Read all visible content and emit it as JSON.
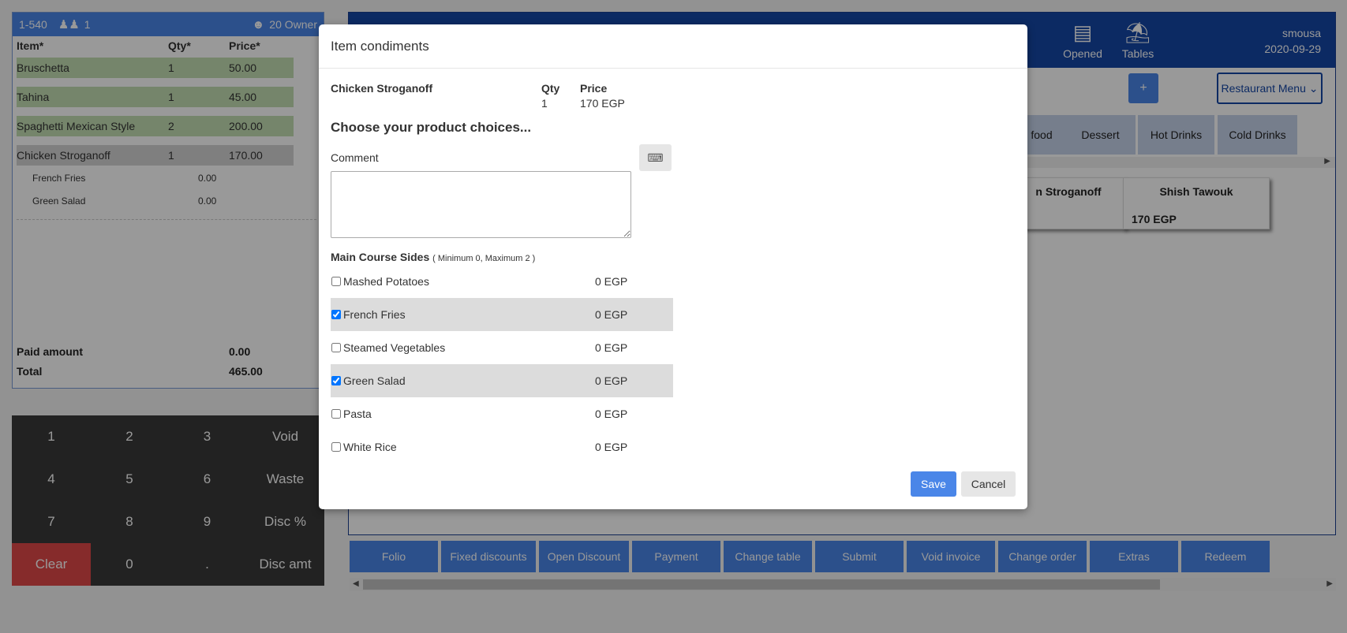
{
  "order": {
    "header": {
      "ref": "1-540",
      "guests_icon": "people-icon",
      "guests": "1",
      "owner_icon": "waiter-icon",
      "owner": "20 Owner"
    },
    "columns": {
      "item": "Item*",
      "qty": "Qty*",
      "price": "Price*"
    },
    "rows": [
      {
        "name": "Bruschetta",
        "qty": "1",
        "price": "50.00"
      },
      {
        "name": "Tahina",
        "qty": "1",
        "price": "45.00"
      },
      {
        "name": "Spaghetti Mexican Style",
        "qty": "2",
        "price": "200.00"
      },
      {
        "name": "Chicken Stroganoff",
        "qty": "1",
        "price": "170.00"
      }
    ],
    "subitems": [
      {
        "name": "French Fries",
        "price": "0.00"
      },
      {
        "name": "Green Salad",
        "price": "0.00"
      }
    ],
    "paid_label": "Paid amount",
    "paid_value": "0.00",
    "total_label": "Total",
    "total_value": "465.00"
  },
  "keypad": [
    "1",
    "2",
    "3",
    "Void",
    "4",
    "5",
    "6",
    "Waste",
    "7",
    "8",
    "9",
    "Disc %",
    "Clear",
    "0",
    ".",
    "Disc amt"
  ],
  "topbar": {
    "opened_label": "Opened",
    "tables_label": "Tables",
    "user": "smousa",
    "date": "2020-09-29"
  },
  "menu": {
    "plus": "+",
    "select": "Restaurant Menu"
  },
  "categories": [
    "food",
    "Dessert",
    "Hot Drinks",
    "Cold Drinks"
  ],
  "products": [
    {
      "name": "n Stroganoff",
      "price": ""
    },
    {
      "name": "Shish Tawouk",
      "price": "170 EGP"
    }
  ],
  "actions": [
    "Folio",
    "Fixed discounts",
    "Open Discount",
    "Payment",
    "Change table",
    "Submit",
    "Void invoice",
    "Change order",
    "Extras",
    "Redeem"
  ],
  "modal": {
    "title": "Item condiments",
    "item_name": "Chicken Stroganoff",
    "qty_label": "Qty",
    "qty_value": "1",
    "price_label": "Price",
    "price_value": "170 EGP",
    "choose": "Choose your product choices...",
    "comment_label": "Comment",
    "keyboard_icon": "keyboard-icon",
    "sides_title": "Main Course Sides",
    "sides_limits": "( Minimum 0, Maximum 2 )",
    "options": [
      {
        "name": "Mashed Potatoes",
        "price": "0 EGP",
        "checked": false
      },
      {
        "name": "French Fries",
        "price": "0 EGP",
        "checked": true
      },
      {
        "name": "Steamed Vegetables",
        "price": "0 EGP",
        "checked": false
      },
      {
        "name": "Green Salad",
        "price": "0 EGP",
        "checked": true
      },
      {
        "name": "Pasta",
        "price": "0 EGP",
        "checked": false
      },
      {
        "name": "White Rice",
        "price": "0 EGP",
        "checked": false
      }
    ],
    "save": "Save",
    "cancel": "Cancel"
  }
}
